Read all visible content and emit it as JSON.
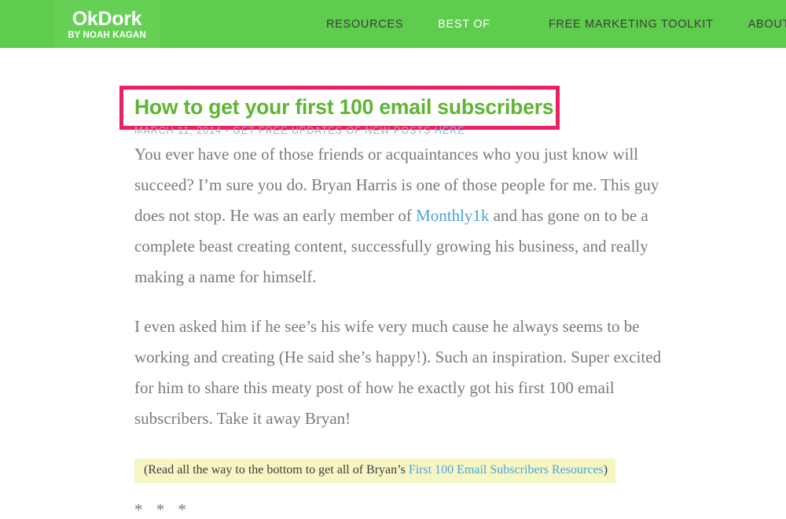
{
  "header": {
    "logo": {
      "title": "OkDork",
      "subtitle": "BY NOAH KAGAN"
    },
    "nav": [
      {
        "label": "RESOURCES",
        "active": false
      },
      {
        "label": "BEST OF",
        "active": true
      },
      {
        "label": "FREE MARKETING TOOLKIT",
        "active": false
      },
      {
        "label": "ABOUT",
        "active": false
      }
    ]
  },
  "post": {
    "title": "How to get your first 100 email subscribers",
    "meta": {
      "date": "MARCH 11, 2014",
      "separator": " - ",
      "text": "GET FREE UPDATES OF NEW POSTS ",
      "link_label": "HERE"
    },
    "paragraphs": {
      "p1_a": "You ever have one of those friends or acquaintances who you just know will succeed? I’m sure you do. Bryan Harris is one of those people for me. This guy does not stop. He was an early member of ",
      "p1_link": "Monthly1k",
      "p1_b": " and has gone on to be a complete beast creating content, successfully growing his business, and really making a name for himself.",
      "p2": "I even asked him if he see’s his wife very much cause he always seems to be working and creating (He said she’s happy!). Such an inspiration. Super excited for him to share this meaty post of how he exactly got his first 100 email subscribers. Take it away Bryan!"
    },
    "callout": {
      "prefix": "(Read all the way to the bottom to get all of Bryan’s ",
      "link_label": "First 100 Email Subscribers Resources",
      "suffix": ")"
    },
    "divider": "* * *"
  },
  "colors": {
    "header_green": "#5ECC4C",
    "logo_green": "#66D055",
    "title_green": "#5EB531",
    "highlight_pink": "#EE1E63",
    "callout_yellow": "#F6F6C4",
    "link_blue": "#4BA3DC",
    "meta_link_blue": "#6FC4E8",
    "body_gray": "#7A7A7A"
  }
}
